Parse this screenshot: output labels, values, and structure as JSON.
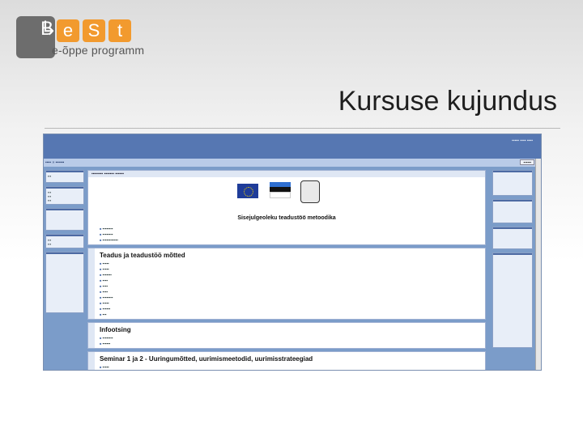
{
  "logo": {
    "letters": [
      "B",
      "e",
      "S",
      "t"
    ],
    "subtitle": "e-õppe programm"
  },
  "title": "Kursuse kujundus",
  "colors": {
    "header": "#5677b2",
    "frame": "#7b9cc9",
    "logo_orange": "#f29a2e",
    "logo_grey": "#6d6d6d"
  },
  "moodle": {
    "main_title": "Sisejulgeoleku teadustöö metoodika",
    "topic1_title": "Teadus ja teadustöö mõtted",
    "topic2_title": "Infootsing",
    "topic3_title": "Seminar 1 ja 2 - Uuringumõtted, uurimismeetodid, uurimisstrateegiad"
  }
}
